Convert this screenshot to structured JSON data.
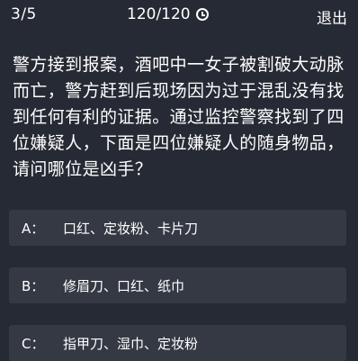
{
  "header": {
    "progress": "3/5",
    "timer": "120/120",
    "exit_label": "退出"
  },
  "question": {
    "text": "警方接到报案，酒吧中一女子被割破大动脉而亡，警方赶到后现场因为过于混乱没有找到任何有利的证据。通过监控警察找到了四位嫌疑人，下面是四位嫌疑人的随身物品，请问哪位是凶手？"
  },
  "options": [
    {
      "letter": "A：",
      "text": "口红、定妆粉、卡片刀"
    },
    {
      "letter": "B：",
      "text": "修眉刀、口红、纸巾"
    },
    {
      "letter": "C：",
      "text": "指甲刀、湿巾、定妆粉"
    }
  ],
  "icons": {
    "timer": "clock-icon"
  }
}
